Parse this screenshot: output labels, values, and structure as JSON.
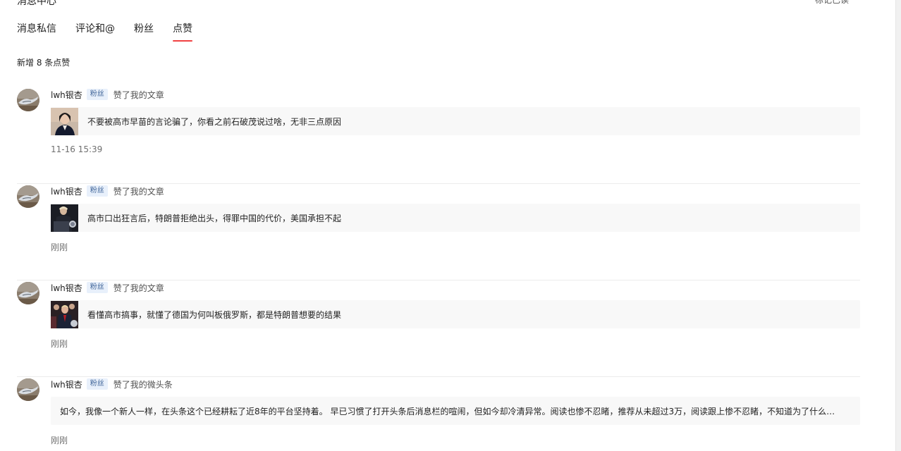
{
  "page": {
    "title": "消息中心",
    "top_right": "标记已读"
  },
  "tabs": [
    {
      "label": "消息私信",
      "active": false
    },
    {
      "label": "评论和@",
      "active": false
    },
    {
      "label": "粉丝",
      "active": false
    },
    {
      "label": "点赞",
      "active": true
    }
  ],
  "summary": "新增 8 条点赞",
  "notifications": [
    {
      "username": "lwh银杏",
      "badge": "粉丝",
      "action": "赞了我的文章",
      "text": "不要被高市早苗的言论骗了，你看之前石破茂说过啥，无非三点原因",
      "time": "11-16 15:39"
    },
    {
      "username": "lwh银杏",
      "badge": "粉丝",
      "action": "赞了我的文章",
      "text": "高市口出狂言后，特朗普拒绝出头，得罪中国的代价，美国承担不起",
      "time": "刚刚"
    },
    {
      "username": "lwh银杏",
      "badge": "粉丝",
      "action": "赞了我的文章",
      "text": "看懂高市搞事，就懂了德国为何叫板俄罗斯，都是特朗普想要的结果",
      "time": "刚刚"
    },
    {
      "username": "lwh银杏",
      "badge": "粉丝",
      "action": "赞了我的微头条",
      "text": "如今，我像一个新人一样，在头条这个已经耕耘了近8年的平台坚持着。 早已习惯了打开头条后消息栏的喧闹，但如今却冷清异常。阅读也惨不忍睹，推荐从未超过3万，阅读跟上惨不忍睹，不知道为了什么，一…",
      "time": "刚刚"
    }
  ],
  "colors": {
    "accent": "#f04142",
    "badge_text": "#406599",
    "badge_bg": "#e8f0fb",
    "card_bg": "#f8f8f8"
  }
}
